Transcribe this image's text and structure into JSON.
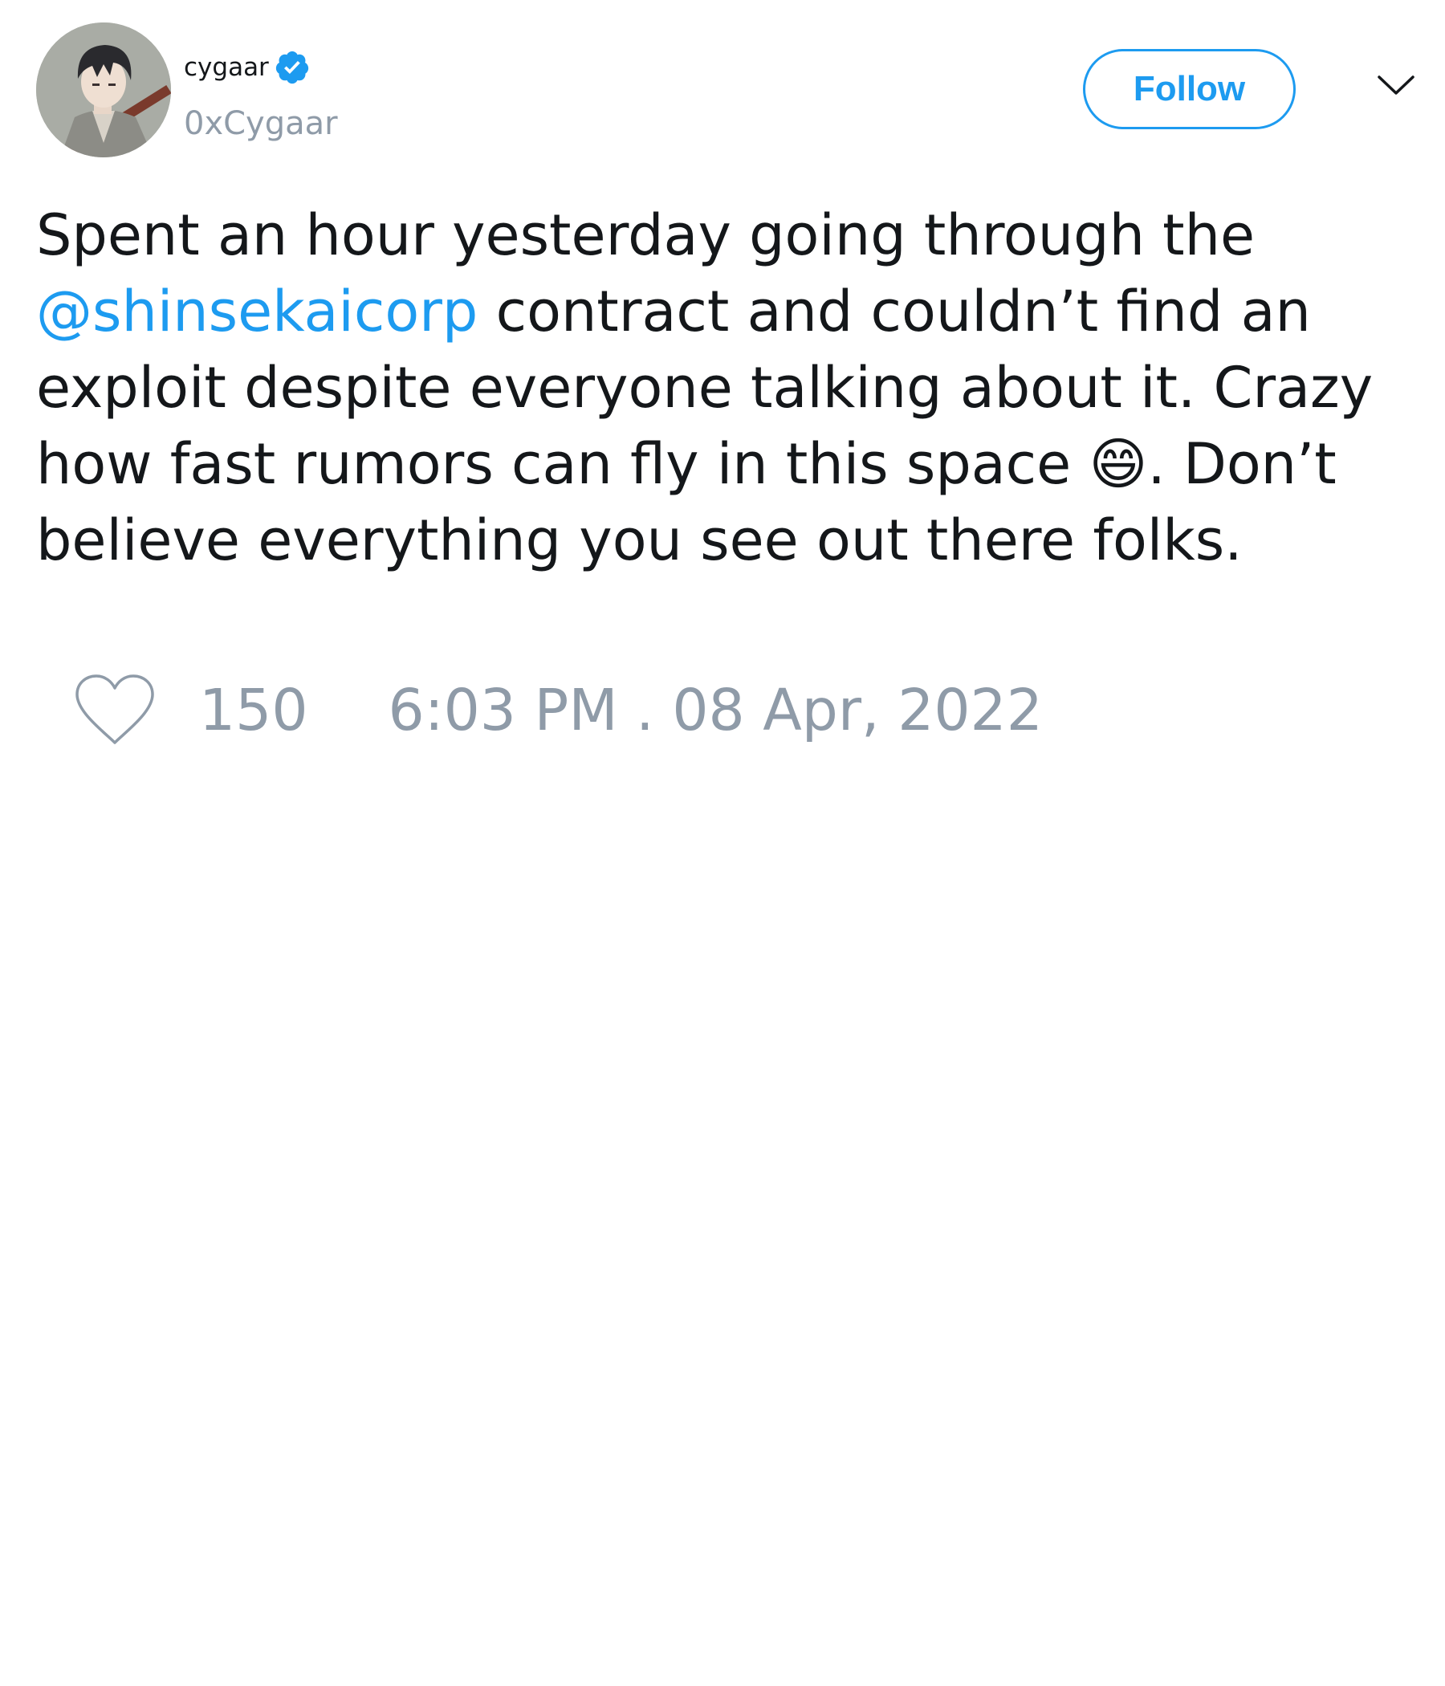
{
  "author": {
    "display_name": "cygaar",
    "username": "0xCygaar",
    "verified": true,
    "avatar_icon": "profile-avatar"
  },
  "actions": {
    "follow_label": "Follow",
    "menu_icon": "chevron-down-icon"
  },
  "tweet": {
    "text_before_mention": "Spent an hour yesterday going through the\n",
    "mention": "@shinsekaicorp",
    "text_after_mention": " contract and couldn’t find an\nexploit despite everyone talking about it. Crazy\nhow fast rumors can fly in this space 😄. Don’t\nbelieve everything you see out there folks."
  },
  "footer": {
    "like_icon": "heart-icon",
    "like_count": "150",
    "timestamp": "6:03 PM . 08 Apr, 2022"
  },
  "colors": {
    "accent": "#1d9bf0",
    "text": "#14171a",
    "muted": "#8f9ba8"
  }
}
